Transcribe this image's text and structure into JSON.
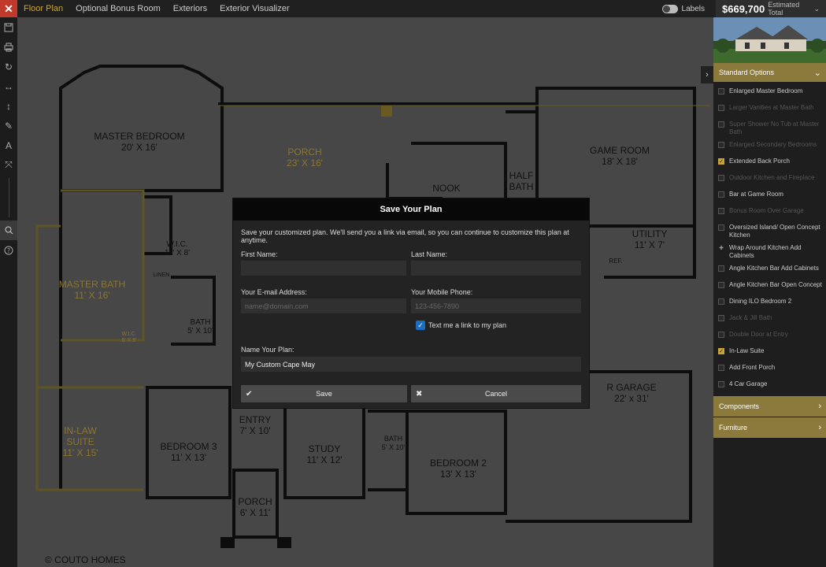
{
  "topbar": {
    "tabs": [
      {
        "label": "Floor Plan",
        "active": true
      },
      {
        "label": "Optional Bonus Room",
        "active": false
      },
      {
        "label": "Exteriors",
        "active": false
      },
      {
        "label": "Exterior Visualizer",
        "active": false
      }
    ],
    "labels_toggle": "Labels",
    "price": "$669,700",
    "price_caption": "Estimated Total"
  },
  "plan": {
    "rooms": [
      {
        "name": "MASTER BEDROOM",
        "size": "20' X 16'"
      },
      {
        "name": "PORCH",
        "size": "23' X 16'"
      },
      {
        "name": "NOOK",
        "size": ""
      },
      {
        "name": "HALF BATH",
        "size": ""
      },
      {
        "name": "GAME ROOM",
        "size": "18' X 18'"
      },
      {
        "name": "UTILITY",
        "size": "11' X 7'"
      },
      {
        "name": "W.I.C.",
        "size": "11' X 8'"
      },
      {
        "name": "LINEN",
        "size": ""
      },
      {
        "name": "MASTER BATH",
        "size": "11' X 16'"
      },
      {
        "name": "BATH",
        "size": "5' X 10'"
      },
      {
        "name": "W.I.C.",
        "size": "6' X 5'"
      },
      {
        "name": "IN-LAW SUITE",
        "size": "11' X 15'"
      },
      {
        "name": "BEDROOM 3",
        "size": "11' X 13'"
      },
      {
        "name": "ENTRY",
        "size": "7' X 10'"
      },
      {
        "name": "STUDY",
        "size": "11' X 12'"
      },
      {
        "name": "BATH",
        "size": "5' X 10'"
      },
      {
        "name": "BEDROOM 2",
        "size": "13' X 13'"
      },
      {
        "name": "R GARAGE",
        "size": "22' x 31'"
      },
      {
        "name": "PORCH",
        "size": "6' X 11'"
      },
      {
        "name": "REF.",
        "size": ""
      }
    ],
    "copyright": "© COUTO HOMES"
  },
  "modal": {
    "title": "Save Your Plan",
    "description": "Save your customized plan. We'll send you a link via email, so you can continue to customize this plan at anytime.",
    "first_name_label": "First Name:",
    "last_name_label": "Last Name:",
    "email_label": "Your E-mail Address:",
    "email_placeholder": "name@domain.com",
    "phone_label": "Your Mobile Phone:",
    "phone_placeholder": "123-456-7890",
    "text_me_label": "Text me a link to my plan",
    "plan_name_label": "Name Your Plan:",
    "plan_name_value": "My Custom Cape May",
    "save_label": "Save",
    "cancel_label": "Cancel"
  },
  "sidebar": {
    "standard_options_label": "Standard Options",
    "options": [
      {
        "label": "Enlarged Master Bedroom",
        "state": "off"
      },
      {
        "label": "Larger Vanities at Master Bath",
        "state": "disabled"
      },
      {
        "label": "Super Shower No Tub at Master Bath",
        "state": "disabled"
      },
      {
        "label": "Enlarged Secondary Bedrooms",
        "state": "disabled"
      },
      {
        "label": "Extended Back Porch",
        "state": "on"
      },
      {
        "label": "Outdoor Kitchen and Fireplace",
        "state": "disabled"
      },
      {
        "label": "Bar at Game Room",
        "state": "off"
      },
      {
        "label": "Bonus Room Over Garage",
        "state": "disabled"
      },
      {
        "label": "Oversized Island/ Open Concept Kitchen",
        "state": "off"
      },
      {
        "label": "Wrap Around Kitchen Add Cabinets",
        "state": "plus"
      },
      {
        "label": "Angle Kitchen Bar Add Cabinets",
        "state": "off"
      },
      {
        "label": "Angle Kitchen Bar Open Concept",
        "state": "off"
      },
      {
        "label": "Dining ILO Bedroom 2",
        "state": "off"
      },
      {
        "label": "Jack & Jill Bath",
        "state": "disabled"
      },
      {
        "label": "Double Door at Entry",
        "state": "disabled"
      },
      {
        "label": "In-Law Suite",
        "state": "on"
      },
      {
        "label": "Add Front Porch",
        "state": "off"
      },
      {
        "label": "4 Car Garage",
        "state": "off"
      }
    ],
    "components_label": "Components",
    "furniture_label": "Furniture"
  }
}
